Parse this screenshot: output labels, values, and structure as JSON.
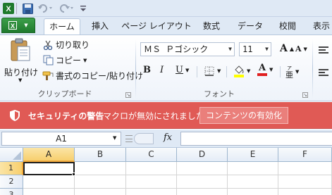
{
  "app": {
    "logo_letter": "X"
  },
  "quick_access": {
    "icons": [
      "excel-logo-icon",
      "save-icon",
      "undo-icon",
      "redo-icon",
      "customize-icon"
    ]
  },
  "tabs": {
    "file_label": "",
    "items": [
      "ホーム",
      "挿入",
      "ページ レイアウト",
      "数式",
      "データ",
      "校閲",
      "表示"
    ],
    "active": "ホーム"
  },
  "ribbon": {
    "clipboard": {
      "paste_label": "貼り付け",
      "cut_label": "切り取り",
      "copy_label": "コピー",
      "format_painter_label": "書式のコピー/貼り付け",
      "group_label": "クリップボード"
    },
    "font": {
      "font_name": "ＭＳ Ｐゴシック",
      "font_size": "11",
      "bold_label": "B",
      "italic_label": "I",
      "underline_label": "U",
      "font_color": "#e02020",
      "fill_color": "#ffff00",
      "group_label": "フォント"
    }
  },
  "security_bar": {
    "title": "セキュリティの警告",
    "message": "マクロが無効にされました。",
    "button_label": "コンテンツの有効化",
    "background": "#e05a55"
  },
  "formula_bar": {
    "name_box": "A1",
    "fx_label": "fx",
    "formula": ""
  },
  "grid": {
    "columns": [
      "A",
      "B",
      "C",
      "D",
      "E",
      "F"
    ],
    "rows": [
      "1",
      "2",
      "3"
    ],
    "selected_cell": "A1"
  }
}
